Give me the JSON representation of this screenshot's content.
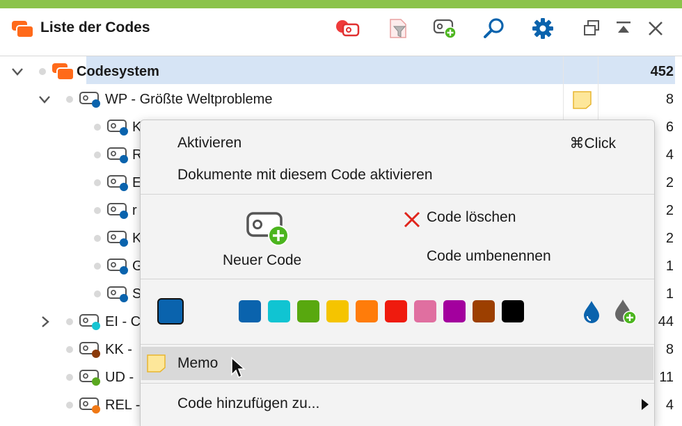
{
  "header": {
    "title": "Liste der Codes",
    "toolbar_icons": [
      "code-reset-icon",
      "filter-icon",
      "new-code-icon",
      "search-icon",
      "settings-icon",
      "undock-icon",
      "collapse-icon",
      "close-icon"
    ]
  },
  "tree": {
    "root": {
      "label": "Codesystem",
      "count": "452"
    },
    "wp": {
      "label": "WP - Größte Weltprobleme",
      "count": "8",
      "color": "#0a63ad"
    },
    "children": [
      {
        "label": "K",
        "count": "6",
        "color": "#0a63ad"
      },
      {
        "label": "R",
        "count": "4",
        "color": "#0a63ad"
      },
      {
        "label": "E",
        "count": "2",
        "color": "#0a63ad"
      },
      {
        "label": "r",
        "count": "2",
        "color": "#0a63ad"
      },
      {
        "label": "K",
        "count": "2",
        "color": "#0a63ad"
      },
      {
        "label": "G",
        "count": "1",
        "color": "#0a63ad"
      },
      {
        "label": "S",
        "count": "1",
        "color": "#0a63ad"
      }
    ],
    "others": [
      {
        "label": "EI - C",
        "count": "44",
        "color": "#17c4d2"
      },
      {
        "label": "KK -",
        "count": "8",
        "color": "#8b3a0a"
      },
      {
        "label": "UD -",
        "count": "11",
        "color": "#5aa820"
      },
      {
        "label": "REL -",
        "count": "4",
        "color": "#f07814"
      }
    ]
  },
  "context_menu": {
    "activate": "Aktivieren",
    "activate_shortcut": "⌘Click",
    "activate_docs": "Dokumente mit diesem Code aktivieren",
    "new_code": "Neuer Code",
    "delete_code": "Code löschen",
    "rename_code": "Code umbenennen",
    "current_color": "#0a63ad",
    "palette": [
      "#0a63ad",
      "#10c4d2",
      "#58a80f",
      "#f5c400",
      "#ff7c0a",
      "#ef1b0e",
      "#e06fa0",
      "#a3009e",
      "#9c3f00",
      "#000000"
    ],
    "memo": "Memo",
    "add_code_to": "Code hinzufügen zu..."
  }
}
